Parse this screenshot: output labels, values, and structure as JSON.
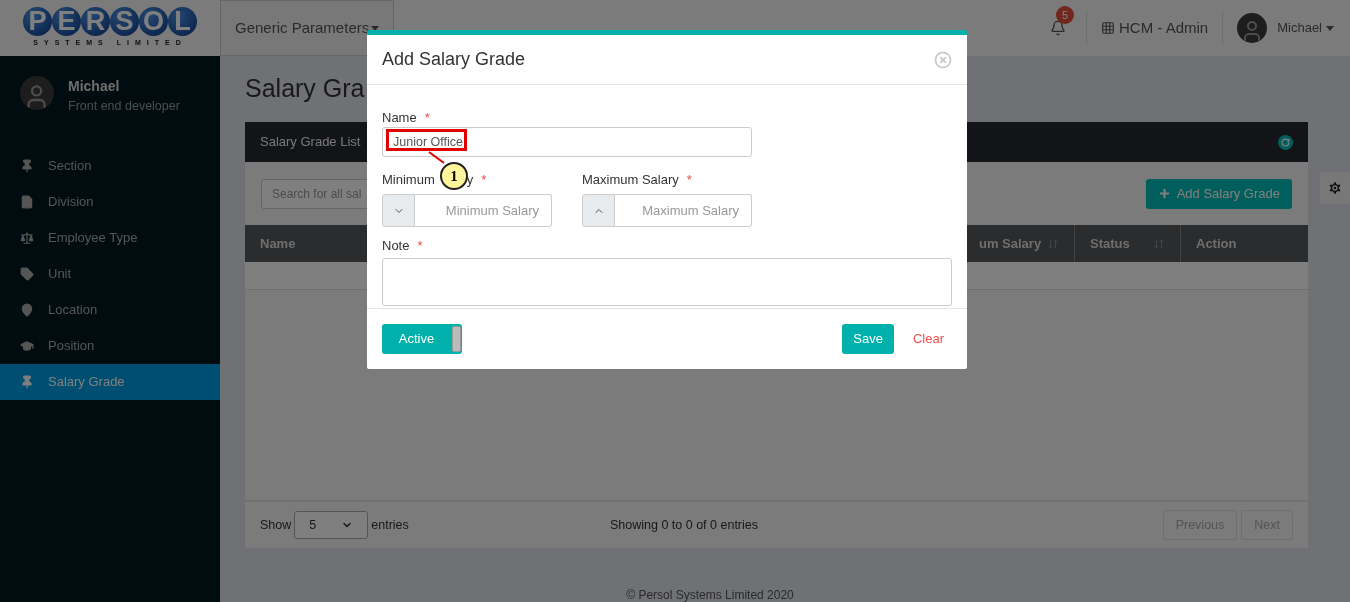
{
  "logo": {
    "letters": [
      "P",
      "E",
      "R",
      "S",
      "O",
      "L"
    ],
    "subtitle": "SYSTEMS LIMITED"
  },
  "header": {
    "menu": "Generic Parameters",
    "notifications": "5",
    "app": "HCM - Admin",
    "user": "Michael"
  },
  "sidebar": {
    "user": {
      "name": "Michael",
      "role": "Front end developer"
    },
    "items": [
      {
        "label": "Section",
        "selected": false
      },
      {
        "label": "Division",
        "selected": false
      },
      {
        "label": "Employee Type",
        "selected": false
      },
      {
        "label": "Unit",
        "selected": false
      },
      {
        "label": "Location",
        "selected": false
      },
      {
        "label": "Position",
        "selected": false
      },
      {
        "label": "Salary Grade",
        "selected": true
      }
    ]
  },
  "page": {
    "title": "Salary Gra"
  },
  "card": {
    "title": "Salary Grade List",
    "search": {
      "placeholder": "Search for all sal"
    },
    "add_button": "Add Salary Grade",
    "columns": [
      {
        "label": "Name"
      },
      {
        "label": "um Salary",
        "sortable": true
      },
      {
        "label": "Status",
        "sortable": true
      },
      {
        "label": "Action",
        "sortable": false
      }
    ],
    "footer": {
      "show_label": "Show",
      "page_size": "5",
      "entries_label": "entries",
      "info": "Showing 0 to 0 of 0 entries",
      "buttons": [
        {
          "label": "Previous",
          "disabled": true
        },
        {
          "label": "Next",
          "disabled": true
        }
      ]
    }
  },
  "copyright": "© Persol Systems Limited 2020",
  "modal": {
    "title": "Add Salary Grade",
    "name": {
      "label": "Name",
      "required_mark": "*",
      "value": "Junior Office"
    },
    "min": {
      "label": "Minimum",
      "label_tail": "y",
      "required_mark": "*",
      "placeholder": "Minimum Salary"
    },
    "max": {
      "label": "Maximum Salary",
      "required_mark": "*",
      "placeholder": "Maximum Salary"
    },
    "note": {
      "label": "Note",
      "required_mark": "*"
    },
    "toggle": {
      "label": "Active",
      "on": true
    },
    "save": "Save",
    "clear": "Clear"
  },
  "callout": {
    "number": "1"
  }
}
